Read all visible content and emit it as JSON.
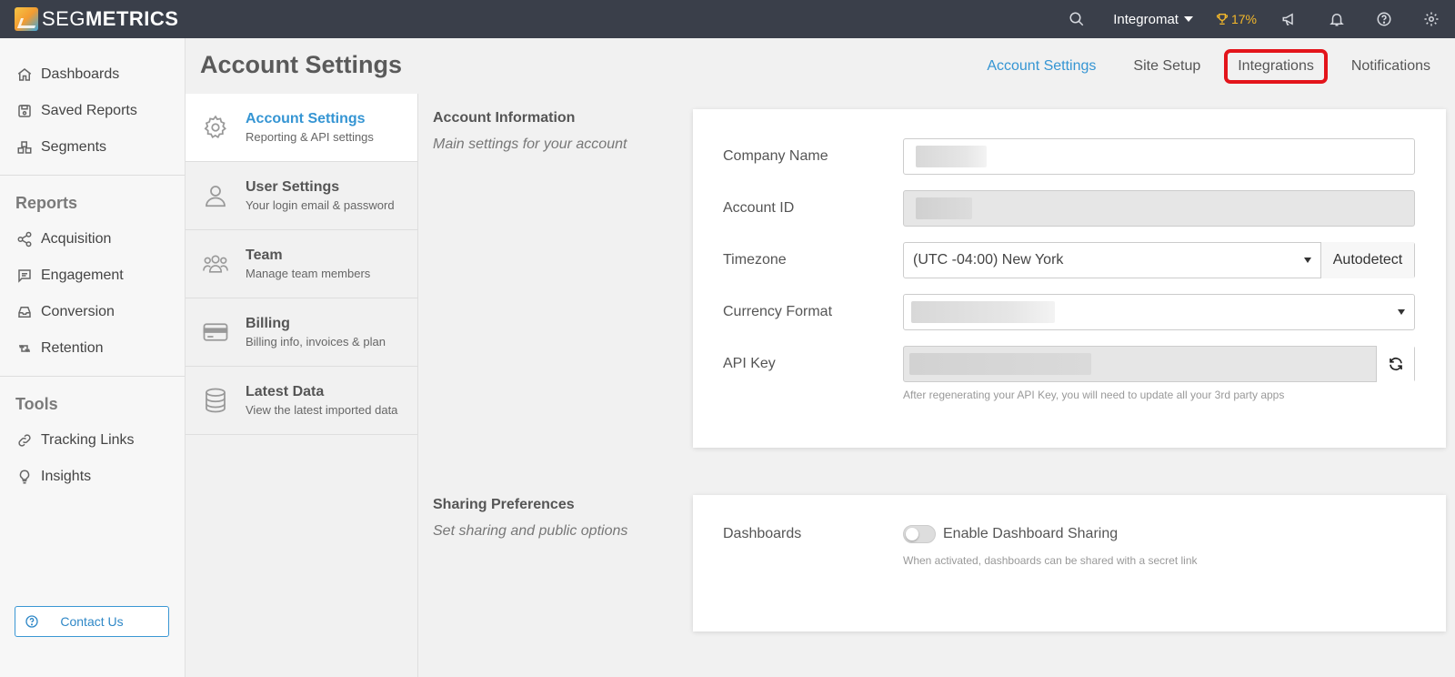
{
  "brand": {
    "name_light": "SEG",
    "name_bold": "METRICS"
  },
  "topbar": {
    "account": "Integromat",
    "progress_percent": 17,
    "progress_label": "17%",
    "icons": [
      "search-icon",
      "trophy-icon",
      "megaphone-icon",
      "bell-icon",
      "help-icon",
      "gear-icon"
    ]
  },
  "sidebar": {
    "main": [
      {
        "label": "Dashboards",
        "icon": "home-icon"
      },
      {
        "label": "Saved Reports",
        "icon": "save-icon"
      },
      {
        "label": "Segments",
        "icon": "segments-icon"
      }
    ],
    "reports_title": "Reports",
    "reports": [
      {
        "label": "Acquisition",
        "icon": "share-icon"
      },
      {
        "label": "Engagement",
        "icon": "comment-icon"
      },
      {
        "label": "Conversion",
        "icon": "inbox-icon"
      },
      {
        "label": "Retention",
        "icon": "retweet-icon"
      }
    ],
    "tools_title": "Tools",
    "tools": [
      {
        "label": "Tracking Links",
        "icon": "link-icon"
      },
      {
        "label": "Insights",
        "icon": "lightbulb-icon"
      }
    ],
    "contact_label": "Contact Us"
  },
  "page": {
    "title": "Account Settings",
    "tabs": [
      {
        "label": "Account Settings",
        "state": "active"
      },
      {
        "label": "Site Setup",
        "state": "normal"
      },
      {
        "label": "Integrations",
        "state": "highlighted"
      },
      {
        "label": "Notifications",
        "state": "normal"
      }
    ]
  },
  "subnav": [
    {
      "title": "Account Settings",
      "desc": "Reporting & API settings",
      "icon": "gear-icon",
      "active": true
    },
    {
      "title": "User Settings",
      "desc": "Your login email & password",
      "icon": "user-icon",
      "active": false
    },
    {
      "title": "Team",
      "desc": "Manage team members",
      "icon": "team-icon",
      "active": false
    },
    {
      "title": "Billing",
      "desc": "Billing info, invoices & plan",
      "icon": "credit-card-icon",
      "active": false
    },
    {
      "title": "Latest Data",
      "desc": "View the latest imported data",
      "icon": "database-icon",
      "active": false
    }
  ],
  "account_info": {
    "title": "Account Information",
    "subtitle": "Main settings for your account",
    "fields": {
      "company_name": {
        "label": "Company Name",
        "value": ""
      },
      "account_id": {
        "label": "Account ID",
        "value": ""
      },
      "timezone": {
        "label": "Timezone",
        "value": "(UTC -04:00) New York",
        "autodetect": "Autodetect"
      },
      "currency": {
        "label": "Currency Format",
        "value": ""
      },
      "api_key": {
        "label": "API Key",
        "value": "",
        "help": "After regenerating your API Key, you will need to update all your 3rd party apps"
      }
    }
  },
  "sharing": {
    "title": "Sharing Preferences",
    "subtitle": "Set sharing and public options",
    "dashboards_label": "Dashboards",
    "toggle_label": "Enable Dashboard Sharing",
    "toggle_on": false,
    "help": "When activated, dashboards can be shared with a secret link"
  }
}
